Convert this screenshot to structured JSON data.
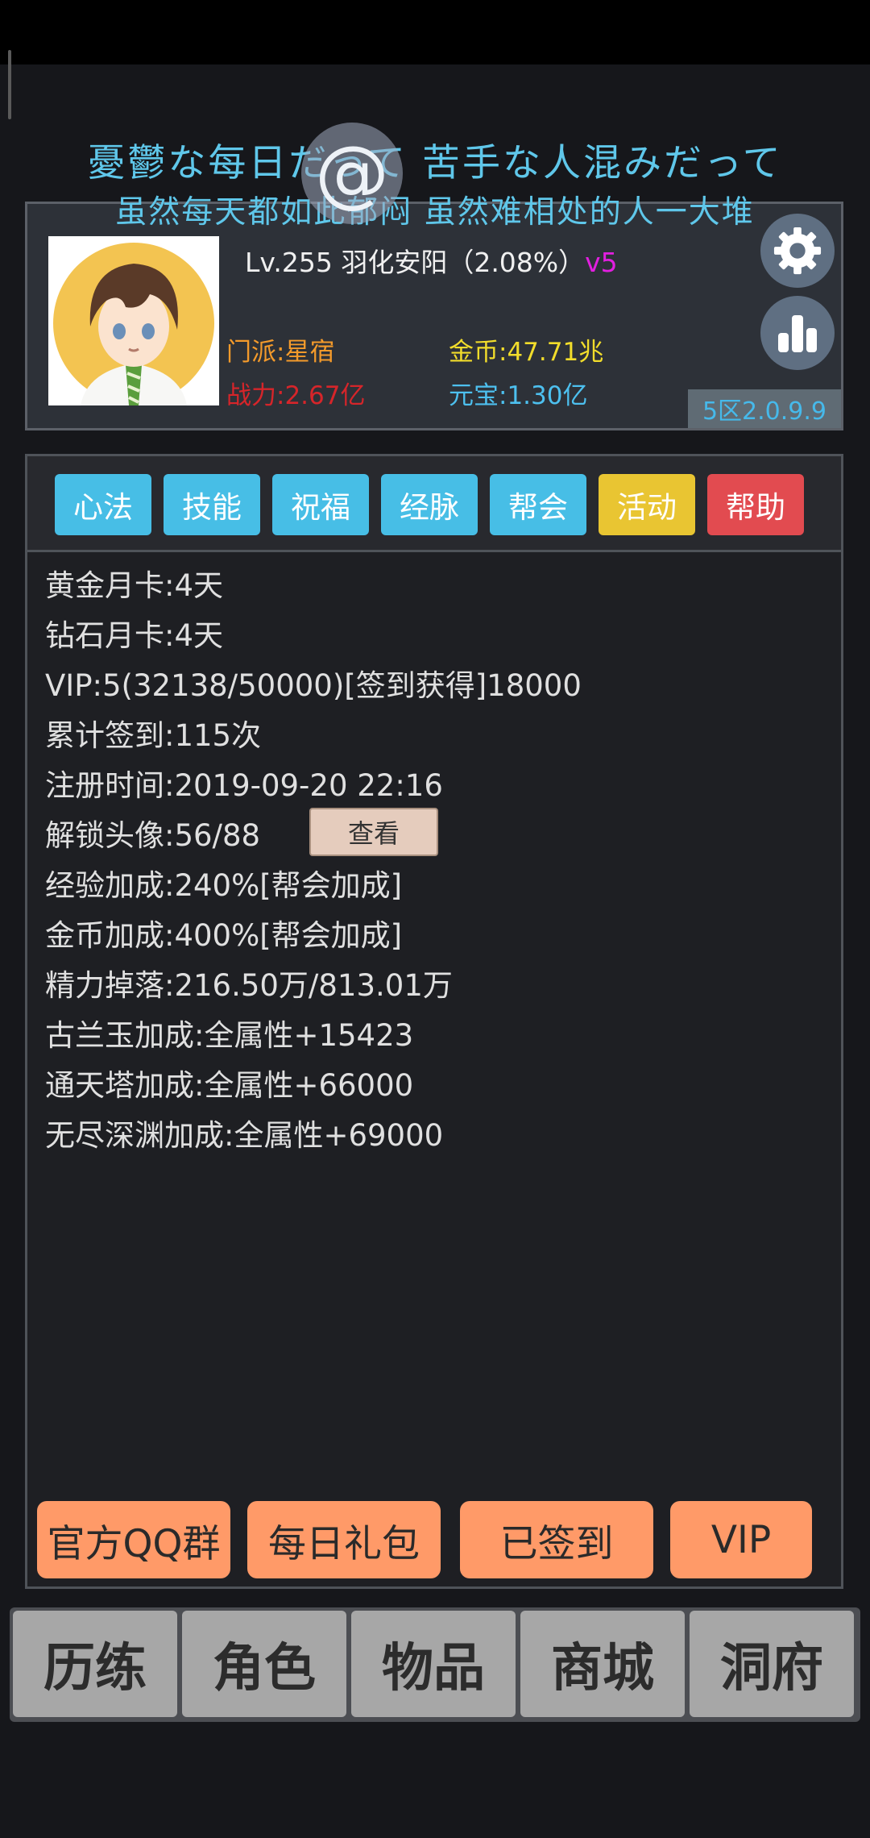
{
  "lyrics": {
    "line1": "憂鬱な每日だって 苦手な人混みだって",
    "line2": "虽然每天都如此郁闷 虽然难相处的人一大堆"
  },
  "at_bubble": "@",
  "profile": {
    "level_name": "Lv.255 羽化安阳（2.08%）",
    "vip": "v5",
    "sect": "门派:星宿",
    "gold": "金币:47.71兆",
    "power": "战力:2.67亿",
    "yuanbao": "元宝:1.30亿",
    "server": "5区2.0.9.9",
    "settings_icon": "gear-icon",
    "stats_icon": "bar-chart-icon"
  },
  "tabs": [
    {
      "label": "心法",
      "color": "#47bee6"
    },
    {
      "label": "技能",
      "color": "#47bee6"
    },
    {
      "label": "祝福",
      "color": "#47bee6"
    },
    {
      "label": "经脉",
      "color": "#47bee6"
    },
    {
      "label": "帮会",
      "color": "#47bee6"
    },
    {
      "label": "活动",
      "color": "#e9c532"
    },
    {
      "label": "帮助",
      "color": "#e24b50"
    }
  ],
  "info": [
    "黄金月卡:4天",
    "钻石月卡:4天",
    "VIP:5(32138/50000)[签到获得]18000",
    "累计签到:115次",
    "注册时间:2019-09-20 22:16",
    "解锁头像:56/88",
    "经验加成:240%[帮会加成]",
    "金币加成:400%[帮会加成]",
    "精力掉落:216.50万/813.01万",
    "古兰玉加成:全属性+15423",
    "通天塔加成:全属性+66000",
    "无尽深渊加成:全属性+69000"
  ],
  "view_button": "查看",
  "actions": [
    "官方QQ群",
    "每日礼包",
    "已签到",
    "VIP"
  ],
  "nav": [
    "历练",
    "角色",
    "物品",
    "商城",
    "洞府"
  ]
}
